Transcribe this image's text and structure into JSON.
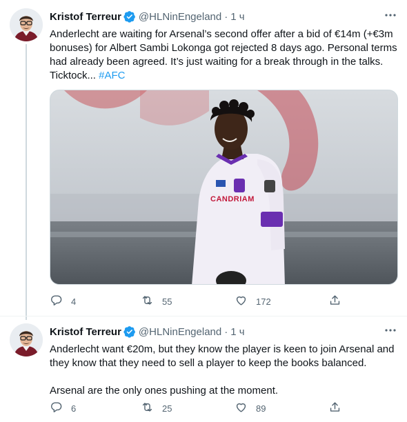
{
  "tweets": [
    {
      "author_name": "Kristof Terreur",
      "handle": "@HLNinEngeland",
      "separator": "·",
      "time": "1 ч",
      "text_main": "Anderlecht are waiting for Arsenal’s second offer after a bid of €14m (+€3m bonuses) for Albert Sambi Lokonga got rejected 8 days ago. Personal terms had already been agreed. It’s just waiting for a break through in the talks. Ticktock... ",
      "hashtag": "#AFC",
      "media_jersey_sponsor": "CANDRIAM",
      "replies": "4",
      "retweets": "55",
      "likes": "172"
    },
    {
      "author_name": "Kristof Terreur",
      "handle": "@HLNinEngeland",
      "separator": "·",
      "time": "1 ч",
      "paragraphs": [
        "Anderlecht want €20m, but they know the player is keen to join Arsenal and they know that they need to sell a player to keep the books balanced.",
        "Arsenal are the only ones pushing at the moment."
      ],
      "replies": "6",
      "retweets": "25",
      "likes": "89"
    }
  ],
  "icons": {
    "verified": "verified-badge-icon",
    "more": "more-dots-icon",
    "reply": "reply-icon",
    "retweet": "retweet-icon",
    "like": "like-icon",
    "share": "share-icon"
  },
  "colors": {
    "accent": "#1d9bf0",
    "text": "#0f1419",
    "secondary": "#536471",
    "border": "#cfd9de",
    "jersey": "#f1eef6",
    "armband": "#6a2fb0"
  }
}
